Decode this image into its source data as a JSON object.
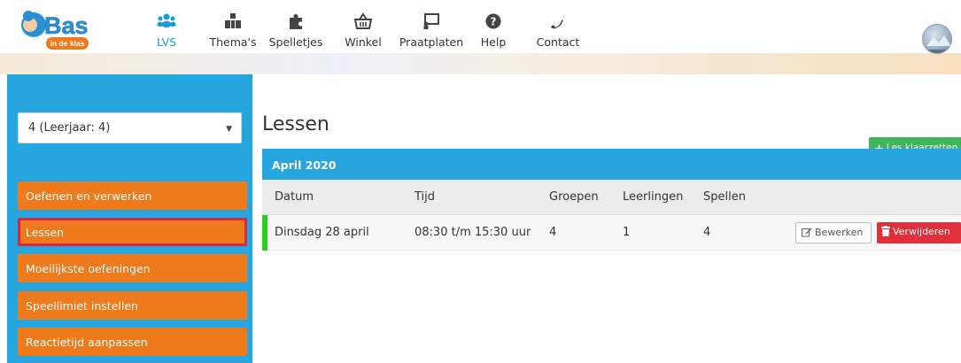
{
  "nav": {
    "items": [
      {
        "label": "LVS",
        "icon": "users-icon",
        "active": true
      },
      {
        "label": "Thema's",
        "icon": "blocks-icon",
        "active": false
      },
      {
        "label": "Spelletjes",
        "icon": "puzzle-icon",
        "active": false
      },
      {
        "label": "Winkel",
        "icon": "basket-icon",
        "active": false
      },
      {
        "label": "Praatplaten",
        "icon": "presentation-icon",
        "active": false
      },
      {
        "label": "Help",
        "icon": "help-icon",
        "active": false
      },
      {
        "label": "Contact",
        "icon": "phone-icon",
        "active": false
      }
    ]
  },
  "logo": {
    "main": "Bas",
    "sub": "in de klas"
  },
  "sidebar": {
    "select_value": "4 (Leerjaar: 4)",
    "items": [
      {
        "label": "Oefenen en verwerken",
        "active": false
      },
      {
        "label": "Lessen",
        "active": true
      },
      {
        "label": "Moeilijkste oefeningen",
        "active": false
      },
      {
        "label": "Speellimiet instellen",
        "active": false
      },
      {
        "label": "Reactietijd aanpassen",
        "active": false
      }
    ]
  },
  "main": {
    "title": "Lessen",
    "add_button": "Les klaarzetten",
    "month": "April 2020",
    "columns": [
      "Datum",
      "Tijd",
      "Groepen",
      "Leerlingen",
      "Spellen"
    ],
    "rows": [
      {
        "datum": "Dinsdag 28 april",
        "tijd": "08:30 t/m 15:30 uur",
        "groepen": "4",
        "leerlingen": "1",
        "spellen": "4",
        "edit_label": "Bewerken",
        "delete_label": "Verwijderen"
      }
    ]
  },
  "colors": {
    "primary_blue": "#27a5de",
    "orange": "#ee7a1b",
    "active_outline": "#d8284a",
    "green": "#3fb659",
    "danger": "#e0303b",
    "row_marker": "#2ecc1f"
  }
}
